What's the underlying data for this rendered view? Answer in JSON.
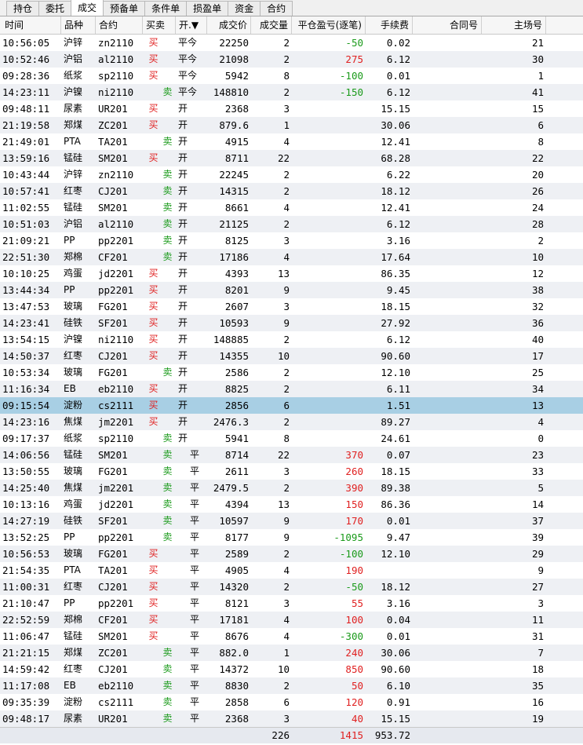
{
  "tabs": [
    {
      "label": "持仓",
      "active": false
    },
    {
      "label": "委托",
      "active": false
    },
    {
      "label": "成交",
      "active": true
    },
    {
      "label": "预备单",
      "active": false
    },
    {
      "label": "条件单",
      "active": false
    },
    {
      "label": "损盈单",
      "active": false
    },
    {
      "label": "资金",
      "active": false
    },
    {
      "label": "合约",
      "active": false
    }
  ],
  "columns": [
    "时间",
    "品种",
    "合约",
    "买卖",
    "开.▼",
    "成交价",
    "成交量",
    "平仓盈亏(逐笔)",
    "手续费",
    "合同号",
    "主场号"
  ],
  "rows": [
    {
      "time": "10:56:05",
      "variety": "沪锌",
      "contract": "zn2110",
      "side": "买",
      "oc": "平今",
      "price": "22250",
      "qty": "2",
      "pl": "-50",
      "fee": "0.02",
      "contract_no": "",
      "seq": "21"
    },
    {
      "time": "10:52:46",
      "variety": "沪铝",
      "contract": "al2110",
      "side": "买",
      "oc": "平今",
      "price": "21098",
      "qty": "2",
      "pl": "275",
      "fee": "6.12",
      "contract_no": "",
      "seq": "30"
    },
    {
      "time": "09:28:36",
      "variety": "纸浆",
      "contract": "sp2110",
      "side": "买",
      "oc": "平今",
      "price": "5942",
      "qty": "8",
      "pl": "-100",
      "fee": "0.01",
      "contract_no": "",
      "seq": "1"
    },
    {
      "time": "14:23:11",
      "variety": "沪镍",
      "contract": "ni2110",
      "side": "卖",
      "oc": "平今",
      "price": "148810",
      "qty": "2",
      "pl": "-150",
      "fee": "6.12",
      "contract_no": "",
      "seq": "41"
    },
    {
      "time": "09:48:11",
      "variety": "尿素",
      "contract": "UR201",
      "side": "买",
      "oc": "开",
      "price": "2368",
      "qty": "3",
      "pl": "",
      "fee": "15.15",
      "contract_no": "",
      "seq": "15"
    },
    {
      "time": "21:19:58",
      "variety": "郑煤",
      "contract": "ZC201",
      "side": "买",
      "oc": "开",
      "price": "879.6",
      "qty": "1",
      "pl": "",
      "fee": "30.06",
      "contract_no": "",
      "seq": "6"
    },
    {
      "time": "21:49:01",
      "variety": "PTA",
      "contract": "TA201",
      "side": "卖",
      "oc": "开",
      "price": "4915",
      "qty": "4",
      "pl": "",
      "fee": "12.41",
      "contract_no": "",
      "seq": "8"
    },
    {
      "time": "13:59:16",
      "variety": "锰硅",
      "contract": "SM201",
      "side": "买",
      "oc": "开",
      "price": "8711",
      "qty": "22",
      "pl": "",
      "fee": "68.28",
      "contract_no": "",
      "seq": "22"
    },
    {
      "time": "10:43:44",
      "variety": "沪锌",
      "contract": "zn2110",
      "side": "卖",
      "oc": "开",
      "price": "22245",
      "qty": "2",
      "pl": "",
      "fee": "6.22",
      "contract_no": "",
      "seq": "20"
    },
    {
      "time": "10:57:41",
      "variety": "红枣",
      "contract": "CJ201",
      "side": "卖",
      "oc": "开",
      "price": "14315",
      "qty": "2",
      "pl": "",
      "fee": "18.12",
      "contract_no": "",
      "seq": "26"
    },
    {
      "time": "11:02:55",
      "variety": "锰硅",
      "contract": "SM201",
      "side": "卖",
      "oc": "开",
      "price": "8661",
      "qty": "4",
      "pl": "",
      "fee": "12.41",
      "contract_no": "",
      "seq": "24"
    },
    {
      "time": "10:51:03",
      "variety": "沪铝",
      "contract": "al2110",
      "side": "卖",
      "oc": "开",
      "price": "21125",
      "qty": "2",
      "pl": "",
      "fee": "6.12",
      "contract_no": "",
      "seq": "28"
    },
    {
      "time": "21:09:21",
      "variety": "PP",
      "contract": "pp2201",
      "side": "卖",
      "oc": "开",
      "price": "8125",
      "qty": "3",
      "pl": "",
      "fee": "3.16",
      "contract_no": "",
      "seq": "2"
    },
    {
      "time": "22:51:30",
      "variety": "郑棉",
      "contract": "CF201",
      "side": "卖",
      "oc": "开",
      "price": "17186",
      "qty": "4",
      "pl": "",
      "fee": "17.64",
      "contract_no": "",
      "seq": "10"
    },
    {
      "time": "10:10:25",
      "variety": "鸡蛋",
      "contract": "jd2201",
      "side": "买",
      "oc": "开",
      "price": "4393",
      "qty": "13",
      "pl": "",
      "fee": "86.35",
      "contract_no": "",
      "seq": "12"
    },
    {
      "time": "13:44:34",
      "variety": "PP",
      "contract": "pp2201",
      "side": "买",
      "oc": "开",
      "price": "8201",
      "qty": "9",
      "pl": "",
      "fee": "9.45",
      "contract_no": "",
      "seq": "38"
    },
    {
      "time": "13:47:53",
      "variety": "玻璃",
      "contract": "FG201",
      "side": "买",
      "oc": "开",
      "price": "2607",
      "qty": "3",
      "pl": "",
      "fee": "18.15",
      "contract_no": "",
      "seq": "32"
    },
    {
      "time": "14:23:41",
      "variety": "硅铁",
      "contract": "SF201",
      "side": "买",
      "oc": "开",
      "price": "10593",
      "qty": "9",
      "pl": "",
      "fee": "27.92",
      "contract_no": "",
      "seq": "36"
    },
    {
      "time": "13:54:15",
      "variety": "沪镍",
      "contract": "ni2110",
      "side": "买",
      "oc": "开",
      "price": "148885",
      "qty": "2",
      "pl": "",
      "fee": "6.12",
      "contract_no": "",
      "seq": "40"
    },
    {
      "time": "14:50:37",
      "variety": "红枣",
      "contract": "CJ201",
      "side": "买",
      "oc": "开",
      "price": "14355",
      "qty": "10",
      "pl": "",
      "fee": "90.60",
      "contract_no": "",
      "seq": "17"
    },
    {
      "time": "10:53:34",
      "variety": "玻璃",
      "contract": "FG201",
      "side": "卖",
      "oc": "开",
      "price": "2586",
      "qty": "2",
      "pl": "",
      "fee": "12.10",
      "contract_no": "",
      "seq": "25"
    },
    {
      "time": "11:16:34",
      "variety": "EB",
      "contract": "eb2110",
      "side": "买",
      "oc": "开",
      "price": "8825",
      "qty": "2",
      "pl": "",
      "fee": "6.11",
      "contract_no": "",
      "seq": "34"
    },
    {
      "time": "09:15:54",
      "variety": "淀粉",
      "contract": "cs2111",
      "side": "买",
      "oc": "开",
      "price": "2856",
      "qty": "6",
      "pl": "",
      "fee": "1.51",
      "contract_no": "",
      "seq": "13",
      "selected": true
    },
    {
      "time": "14:23:16",
      "variety": "焦煤",
      "contract": "jm2201",
      "side": "买",
      "oc": "开",
      "price": "2476.3",
      "qty": "2",
      "pl": "",
      "fee": "89.27",
      "contract_no": "",
      "seq": "4"
    },
    {
      "time": "09:17:37",
      "variety": "纸浆",
      "contract": "sp2110",
      "side": "卖",
      "oc": "开",
      "price": "5941",
      "qty": "8",
      "pl": "",
      "fee": "24.61",
      "contract_no": "",
      "seq": "0"
    },
    {
      "time": "14:06:56",
      "variety": "锰硅",
      "contract": "SM201",
      "side": "卖",
      "oc": "平",
      "price": "8714",
      "qty": "22",
      "pl": "370",
      "fee": "0.07",
      "contract_no": "",
      "seq": "23"
    },
    {
      "time": "13:50:55",
      "variety": "玻璃",
      "contract": "FG201",
      "side": "卖",
      "oc": "平",
      "price": "2611",
      "qty": "3",
      "pl": "260",
      "fee": "18.15",
      "contract_no": "",
      "seq": "33"
    },
    {
      "time": "14:25:40",
      "variety": "焦煤",
      "contract": "jm2201",
      "side": "卖",
      "oc": "平",
      "price": "2479.5",
      "qty": "2",
      "pl": "390",
      "fee": "89.38",
      "contract_no": "",
      "seq": "5"
    },
    {
      "time": "10:13:16",
      "variety": "鸡蛋",
      "contract": "jd2201",
      "side": "卖",
      "oc": "平",
      "price": "4394",
      "qty": "13",
      "pl": "150",
      "fee": "86.36",
      "contract_no": "",
      "seq": "14"
    },
    {
      "time": "14:27:19",
      "variety": "硅铁",
      "contract": "SF201",
      "side": "卖",
      "oc": "平",
      "price": "10597",
      "qty": "9",
      "pl": "170",
      "fee": "0.01",
      "contract_no": "",
      "seq": "37"
    },
    {
      "time": "13:52:25",
      "variety": "PP",
      "contract": "pp2201",
      "side": "卖",
      "oc": "平",
      "price": "8177",
      "qty": "9",
      "pl": "-1095",
      "fee": "9.47",
      "contract_no": "",
      "seq": "39"
    },
    {
      "time": "10:56:53",
      "variety": "玻璃",
      "contract": "FG201",
      "side": "买",
      "oc": "平",
      "price": "2589",
      "qty": "2",
      "pl": "-100",
      "fee": "12.10",
      "contract_no": "",
      "seq": "29"
    },
    {
      "time": "21:54:35",
      "variety": "PTA",
      "contract": "TA201",
      "side": "买",
      "oc": "平",
      "price": "4905",
      "qty": "4",
      "pl": "190",
      "fee": "",
      "contract_no": "",
      "seq": "9"
    },
    {
      "time": "11:00:31",
      "variety": "红枣",
      "contract": "CJ201",
      "side": "买",
      "oc": "平",
      "price": "14320",
      "qty": "2",
      "pl": "-50",
      "fee": "18.12",
      "contract_no": "",
      "seq": "27"
    },
    {
      "time": "21:10:47",
      "variety": "PP",
      "contract": "pp2201",
      "side": "买",
      "oc": "平",
      "price": "8121",
      "qty": "3",
      "pl": "55",
      "fee": "3.16",
      "contract_no": "",
      "seq": "3"
    },
    {
      "time": "22:52:59",
      "variety": "郑棉",
      "contract": "CF201",
      "side": "买",
      "oc": "平",
      "price": "17181",
      "qty": "4",
      "pl": "100",
      "fee": "0.04",
      "contract_no": "",
      "seq": "11"
    },
    {
      "time": "11:06:47",
      "variety": "锰硅",
      "contract": "SM201",
      "side": "买",
      "oc": "平",
      "price": "8676",
      "qty": "4",
      "pl": "-300",
      "fee": "0.01",
      "contract_no": "",
      "seq": "31"
    },
    {
      "time": "21:21:15",
      "variety": "郑煤",
      "contract": "ZC201",
      "side": "卖",
      "oc": "平",
      "price": "882.0",
      "qty": "1",
      "pl": "240",
      "fee": "30.06",
      "contract_no": "",
      "seq": "7"
    },
    {
      "time": "14:59:42",
      "variety": "红枣",
      "contract": "CJ201",
      "side": "卖",
      "oc": "平",
      "price": "14372",
      "qty": "10",
      "pl": "850",
      "fee": "90.60",
      "contract_no": "",
      "seq": "18"
    },
    {
      "time": "11:17:08",
      "variety": "EB",
      "contract": "eb2110",
      "side": "卖",
      "oc": "平",
      "price": "8830",
      "qty": "2",
      "pl": "50",
      "fee": "6.10",
      "contract_no": "",
      "seq": "35"
    },
    {
      "time": "09:35:39",
      "variety": "淀粉",
      "contract": "cs2111",
      "side": "卖",
      "oc": "平",
      "price": "2858",
      "qty": "6",
      "pl": "120",
      "fee": "0.91",
      "contract_no": "",
      "seq": "16"
    },
    {
      "time": "09:48:17",
      "variety": "尿素",
      "contract": "UR201",
      "side": "卖",
      "oc": "平",
      "price": "2368",
      "qty": "3",
      "pl": "40",
      "fee": "15.15",
      "contract_no": "",
      "seq": "19"
    }
  ],
  "totals": {
    "qty": "226",
    "pl": "1415",
    "fee": "953.72"
  },
  "colors": {
    "buy": "#e02020",
    "sell": "#1a9a1a",
    "selected_row": "#a8cfe4"
  }
}
